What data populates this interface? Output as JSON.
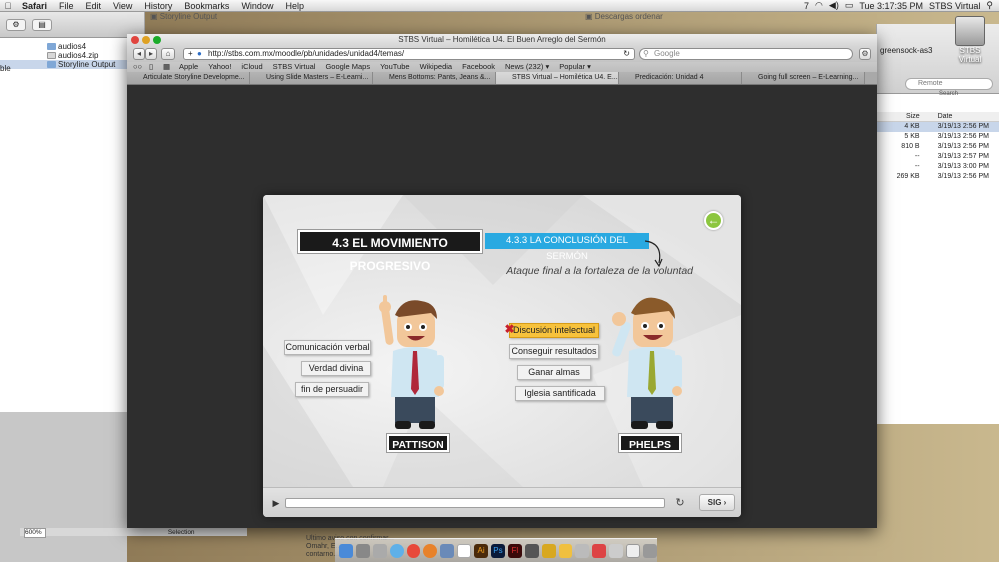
{
  "menubar": {
    "apple": "",
    "items": [
      "Safari",
      "File",
      "Edit",
      "View",
      "History",
      "Bookmarks",
      "Window",
      "Help"
    ],
    "clock": "Tue 3:17:35 PM",
    "user": "STBS Virtual",
    "status_num": "7"
  },
  "finder": {
    "window_title": "Storyline Output",
    "files": [
      {
        "name": "audios4"
      },
      {
        "name": "audios4.zip"
      },
      {
        "name": "Storyline Output"
      }
    ],
    "side_label": "ble",
    "zoom": "600%",
    "selection_label": "Selection"
  },
  "downloads": {
    "window_title": "Descargas ordenar"
  },
  "right_finder": {
    "search_placeholder": "Remote",
    "search_label": "Search",
    "col_size": "Size",
    "col_date": "Date",
    "rows": [
      {
        "size": "4 KB",
        "date": "3/19/13 2:56 PM"
      },
      {
        "size": "5 KB",
        "date": "3/19/13 2:56 PM"
      },
      {
        "size": "810 B",
        "date": "3/19/13 2:56 PM"
      },
      {
        "size": "--",
        "date": "3/19/13 2:57 PM"
      },
      {
        "size": "--",
        "date": "3/19/13 3:00 PM"
      },
      {
        "size": "269 KB",
        "date": "3/19/13 2:56 PM"
      }
    ],
    "side_item": "greensock-as3"
  },
  "desktop": {
    "hdd_label": "STBS Virtual"
  },
  "browser": {
    "title": "STBS Virtual – Homilética U4. El Buen Arreglo del Sermón",
    "url": "http://stbs.com.mx/moodle/pb/unidades/unidad4/temas/",
    "search_placeholder": "Google",
    "bookmarks": [
      "Apple",
      "Yahoo!",
      "iCloud",
      "STBS Virtual",
      "Google Maps",
      "YouTube",
      "Wikipedia",
      "Facebook",
      "News (232) ▾",
      "Popular ▾"
    ],
    "tabs": [
      "Articulate Storyline Developme...",
      "Using Slide Masters – E-Learni...",
      "Mens Bottoms: Pants, Jeans &...",
      "STBS Virtual – Homilética U4. E...",
      "Predicación: Unidad 4",
      "Going full screen – E-Learning..."
    ]
  },
  "slide": {
    "title": "4.3 EL MOVIMIENTO PROGRESIVO",
    "subtitle": "4.3.3 LA CONCLUSIÓN DEL SERMÓN",
    "tagline": "Ataque final a la fortaleza de la voluntad",
    "left_options": [
      "Comunicación verbal",
      "Verdad divina",
      "fin de persuadir"
    ],
    "right_options": [
      "Discusión intelectual",
      "Conseguir resultados",
      "Ganar almas",
      "Iglesia santificada"
    ],
    "left_name": "PATTISON",
    "right_name": "PHELPS",
    "back_icon": "←",
    "next_label": "SIG"
  },
  "mail": {
    "line1": "Ultimo aviso con confirmar...",
    "line2": "Omahr, E...",
    "line3": "contarno..."
  },
  "colors": {
    "accent_blue": "#29a9e1",
    "highlight_yellow": "#f7c23c",
    "back_green": "#8cc63f"
  }
}
